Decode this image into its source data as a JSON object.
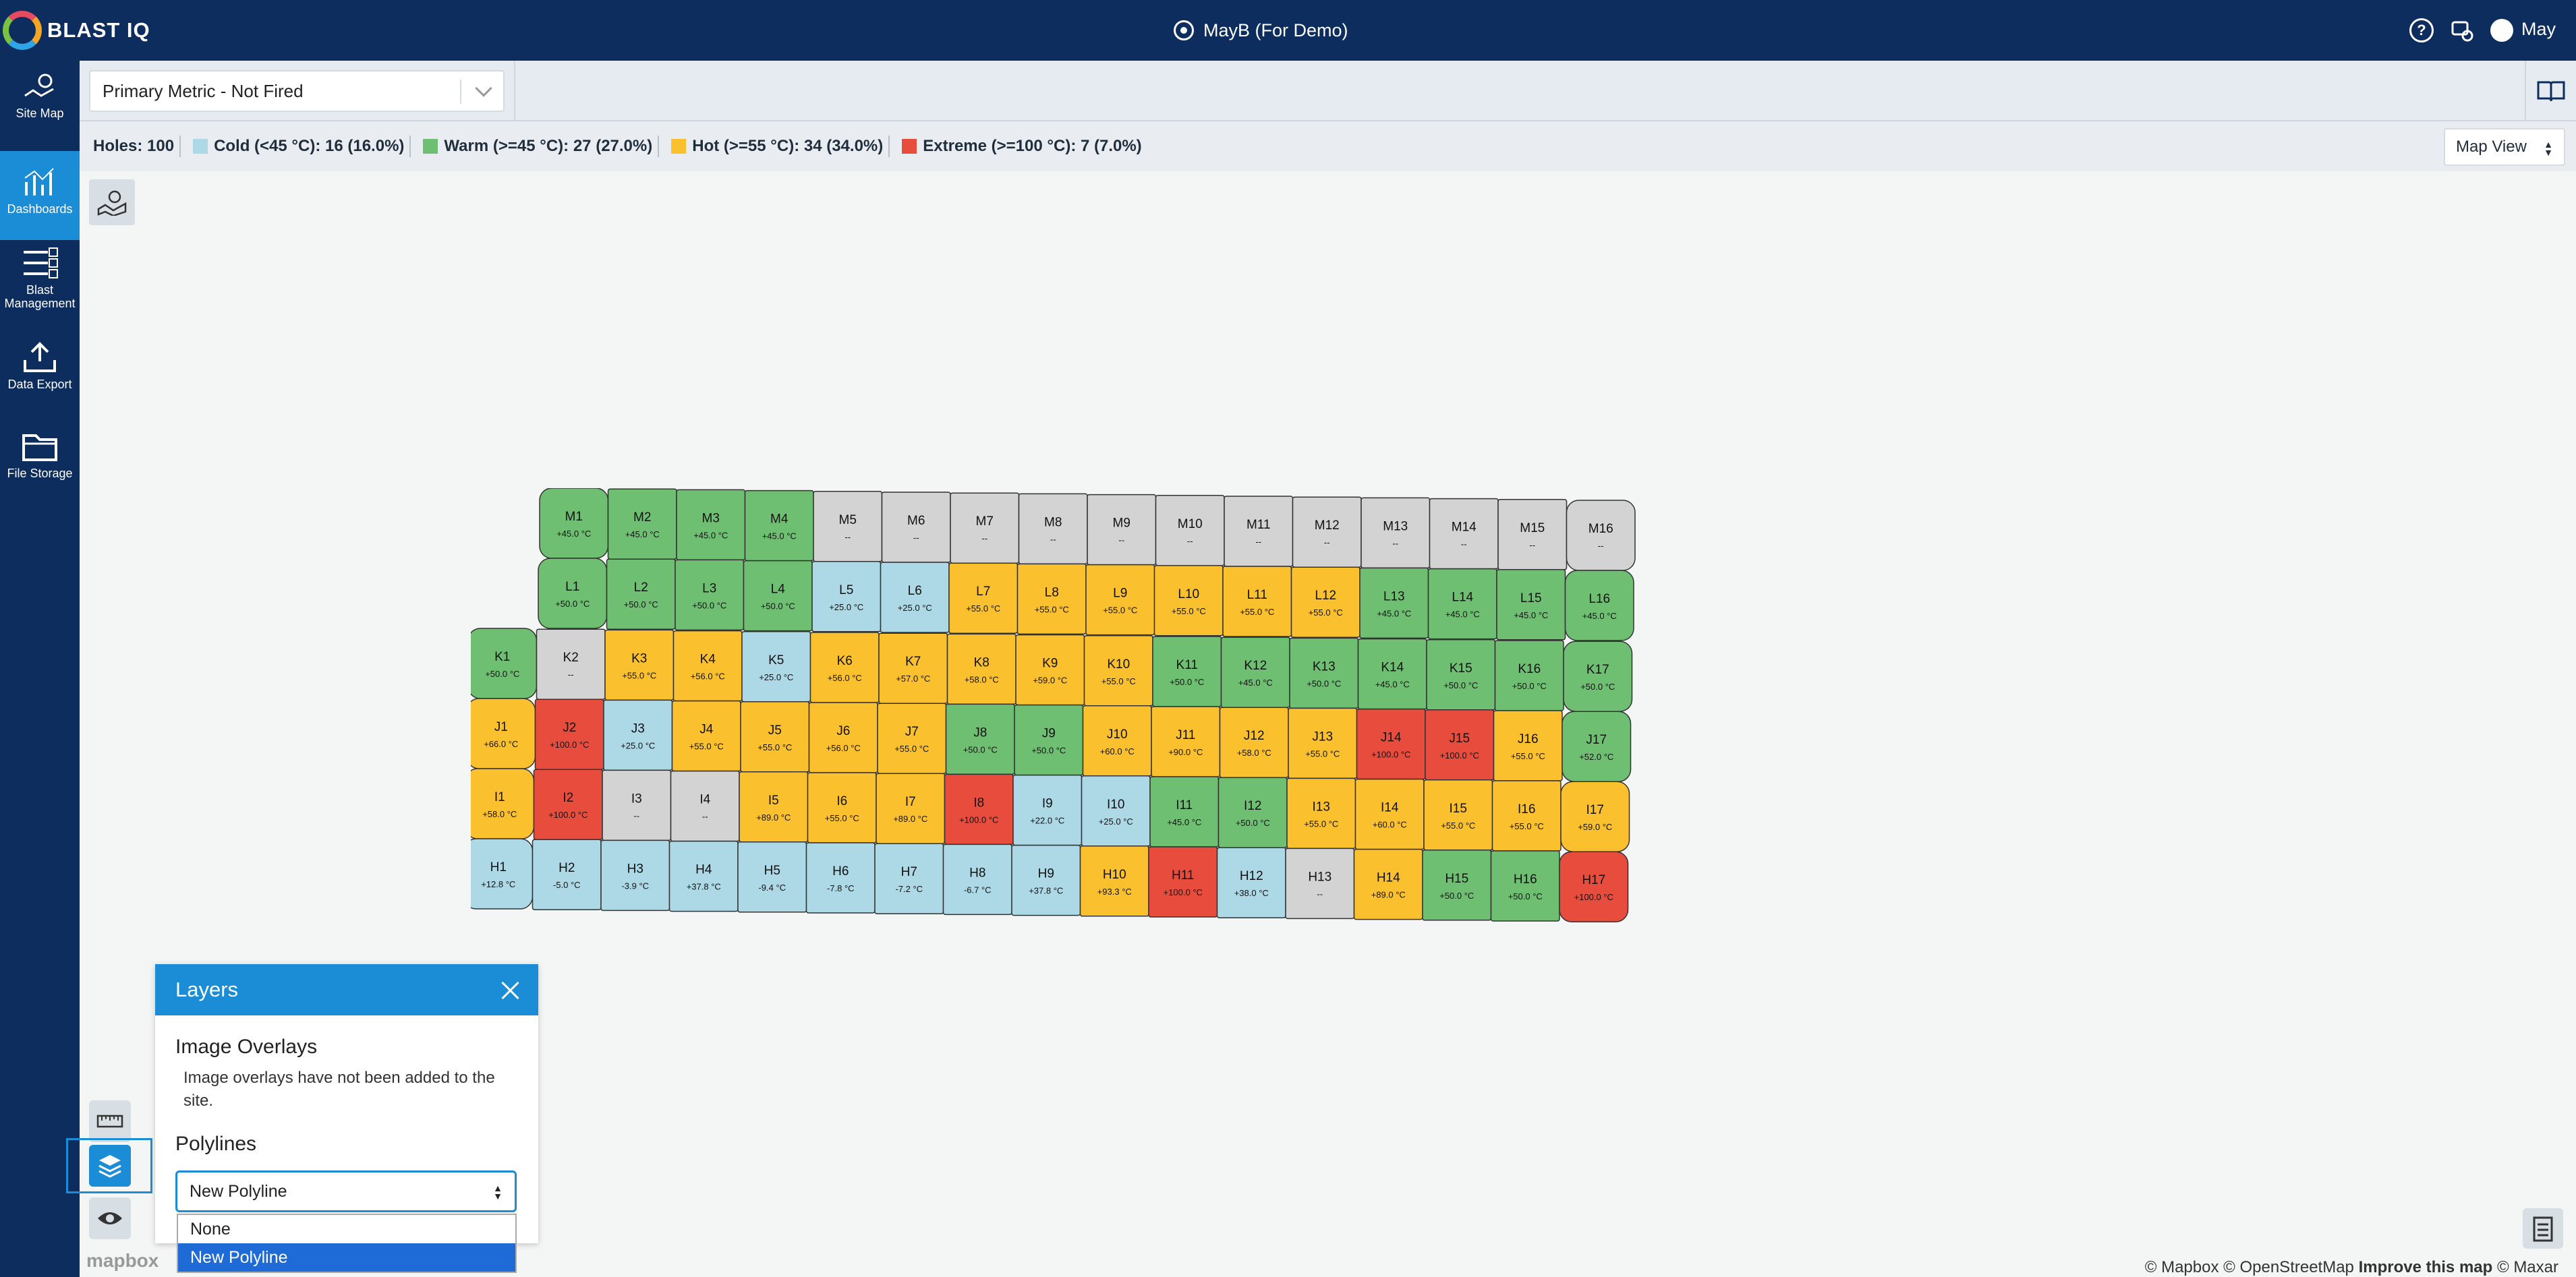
{
  "app": {
    "brand": "BLAST IQ",
    "site_title": "MayB (For Demo)",
    "user": "May"
  },
  "sidebar": {
    "items": [
      {
        "label": "Site Map",
        "icon": "map-icon",
        "active": false
      },
      {
        "label": "Dashboards",
        "icon": "chart-icon",
        "active": true
      },
      {
        "label": "Blast Management",
        "icon": "list-icon",
        "active": false
      },
      {
        "label": "Data Export",
        "icon": "upload-icon",
        "active": false
      },
      {
        "label": "File Storage",
        "icon": "folder-icon",
        "active": false
      }
    ]
  },
  "toolbar": {
    "metric": "Primary Metric - Not Fired"
  },
  "legend": {
    "holes": "Holes: 100",
    "items": [
      {
        "label": "Cold (<45 °C): 16 (16.0%)",
        "color": "#add8e6"
      },
      {
        "label": "Warm (>=45 °C): 27 (27.0%)",
        "color": "#6fbf73"
      },
      {
        "label": "Hot (>=55 °C): 34 (34.0%)",
        "color": "#fbc02d"
      },
      {
        "label": "Extreme (>=100 °C): 7 (7.0%)",
        "color": "#e74c3c"
      }
    ],
    "view": "Map View"
  },
  "colors": {
    "cold": "#add8e6",
    "warm": "#6fbf73",
    "hot": "#fbc02d",
    "extreme": "#e74c3c",
    "none": "#d3d3d3"
  },
  "grid": {
    "rows": [
      {
        "row": "M",
        "cells": [
          [
            "M1",
            "+45.0 °C",
            "warm"
          ],
          [
            "M2",
            "+45.0 °C",
            "warm"
          ],
          [
            "M3",
            "+45.0 °C",
            "warm"
          ],
          [
            "M4",
            "+45.0 °C",
            "warm"
          ],
          [
            "M5",
            "--",
            "none"
          ],
          [
            "M6",
            "--",
            "none"
          ],
          [
            "M7",
            "--",
            "none"
          ],
          [
            "M8",
            "--",
            "none"
          ],
          [
            "M9",
            "--",
            "none"
          ],
          [
            "M10",
            "--",
            "none"
          ],
          [
            "M11",
            "--",
            "none"
          ],
          [
            "M12",
            "--",
            "none"
          ],
          [
            "M13",
            "--",
            "none"
          ],
          [
            "M14",
            "--",
            "none"
          ],
          [
            "M15",
            "--",
            "none"
          ],
          [
            "M16",
            "--",
            "none"
          ]
        ]
      },
      {
        "row": "L",
        "cells": [
          [
            "L1",
            "+50.0 °C",
            "warm"
          ],
          [
            "L2",
            "+50.0 °C",
            "warm"
          ],
          [
            "L3",
            "+50.0 °C",
            "warm"
          ],
          [
            "L4",
            "+50.0 °C",
            "warm"
          ],
          [
            "L5",
            "+25.0 °C",
            "cold"
          ],
          [
            "L6",
            "+25.0 °C",
            "cold"
          ],
          [
            "L7",
            "+55.0 °C",
            "hot"
          ],
          [
            "L8",
            "+55.0 °C",
            "hot"
          ],
          [
            "L9",
            "+55.0 °C",
            "hot"
          ],
          [
            "L10",
            "+55.0 °C",
            "hot"
          ],
          [
            "L11",
            "+55.0 °C",
            "hot"
          ],
          [
            "L12",
            "+55.0 °C",
            "hot"
          ],
          [
            "L13",
            "+45.0 °C",
            "warm"
          ],
          [
            "L14",
            "+45.0 °C",
            "warm"
          ],
          [
            "L15",
            "+45.0 °C",
            "warm"
          ],
          [
            "L16",
            "+45.0 °C",
            "warm"
          ]
        ]
      },
      {
        "row": "K",
        "cells": [
          [
            "K1",
            "+50.0 °C",
            "warm"
          ],
          [
            "K2",
            "--",
            "none"
          ],
          [
            "K3",
            "+55.0 °C",
            "hot"
          ],
          [
            "K4",
            "+56.0 °C",
            "hot"
          ],
          [
            "K5",
            "+25.0 °C",
            "cold"
          ],
          [
            "K6",
            "+56.0 °C",
            "hot"
          ],
          [
            "K7",
            "+57.0 °C",
            "hot"
          ],
          [
            "K8",
            "+58.0 °C",
            "hot"
          ],
          [
            "K9",
            "+59.0 °C",
            "hot"
          ],
          [
            "K10",
            "+55.0 °C",
            "hot"
          ],
          [
            "K11",
            "+50.0 °C",
            "warm"
          ],
          [
            "K12",
            "+45.0 °C",
            "warm"
          ],
          [
            "K13",
            "+50.0 °C",
            "warm"
          ],
          [
            "K14",
            "+45.0 °C",
            "warm"
          ],
          [
            "K15",
            "+50.0 °C",
            "warm"
          ],
          [
            "K16",
            "+50.0 °C",
            "warm"
          ],
          [
            "K17",
            "+50.0 °C",
            "warm"
          ]
        ]
      },
      {
        "row": "J",
        "cells": [
          [
            "J1",
            "+66.0 °C",
            "hot"
          ],
          [
            "J2",
            "+100.0 °C",
            "extreme"
          ],
          [
            "J3",
            "+25.0 °C",
            "cold"
          ],
          [
            "J4",
            "+55.0 °C",
            "hot"
          ],
          [
            "J5",
            "+55.0 °C",
            "hot"
          ],
          [
            "J6",
            "+56.0 °C",
            "hot"
          ],
          [
            "J7",
            "+55.0 °C",
            "hot"
          ],
          [
            "J8",
            "+50.0 °C",
            "warm"
          ],
          [
            "J9",
            "+50.0 °C",
            "warm"
          ],
          [
            "J10",
            "+60.0 °C",
            "hot"
          ],
          [
            "J11",
            "+90.0 °C",
            "hot"
          ],
          [
            "J12",
            "+58.0 °C",
            "hot"
          ],
          [
            "J13",
            "+55.0 °C",
            "hot"
          ],
          [
            "J14",
            "+100.0 °C",
            "extreme"
          ],
          [
            "J15",
            "+100.0 °C",
            "extreme"
          ],
          [
            "J16",
            "+55.0 °C",
            "hot"
          ],
          [
            "J17",
            "+52.0 °C",
            "warm"
          ]
        ]
      },
      {
        "row": "I",
        "cells": [
          [
            "I1",
            "+58.0 °C",
            "hot"
          ],
          [
            "I2",
            "+100.0 °C",
            "extreme"
          ],
          [
            "I3",
            "--",
            "none"
          ],
          [
            "I4",
            "--",
            "none"
          ],
          [
            "I5",
            "+89.0 °C",
            "hot"
          ],
          [
            "I6",
            "+55.0 °C",
            "hot"
          ],
          [
            "I7",
            "+89.0 °C",
            "hot"
          ],
          [
            "I8",
            "+100.0 °C",
            "extreme"
          ],
          [
            "I9",
            "+22.0 °C",
            "cold"
          ],
          [
            "I10",
            "+25.0 °C",
            "cold"
          ],
          [
            "I11",
            "+45.0 °C",
            "warm"
          ],
          [
            "I12",
            "+50.0 °C",
            "warm"
          ],
          [
            "I13",
            "+55.0 °C",
            "hot"
          ],
          [
            "I14",
            "+60.0 °C",
            "hot"
          ],
          [
            "I15",
            "+55.0 °C",
            "hot"
          ],
          [
            "I16",
            "+55.0 °C",
            "hot"
          ],
          [
            "I17",
            "+59.0 °C",
            "hot"
          ]
        ]
      },
      {
        "row": "H",
        "cells": [
          [
            "H1",
            "+12.8 °C",
            "cold"
          ],
          [
            "H2",
            "-5.0 °C",
            "cold"
          ],
          [
            "H3",
            "-3.9 °C",
            "cold"
          ],
          [
            "H4",
            "+37.8 °C",
            "cold"
          ],
          [
            "H5",
            "-9.4 °C",
            "cold"
          ],
          [
            "H6",
            "-7.8 °C",
            "cold"
          ],
          [
            "H7",
            "-7.2 °C",
            "cold"
          ],
          [
            "H8",
            "-6.7 °C",
            "cold"
          ],
          [
            "H9",
            "+37.8 °C",
            "cold"
          ],
          [
            "H10",
            "+93.3 °C",
            "hot"
          ],
          [
            "H11",
            "+100.0 °C",
            "extreme"
          ],
          [
            "H12",
            "+38.0 °C",
            "cold"
          ],
          [
            "H13",
            "--",
            "none"
          ],
          [
            "H14",
            "+89.0 °C",
            "hot"
          ],
          [
            "H15",
            "+50.0 °C",
            "warm"
          ],
          [
            "H16",
            "+50.0 °C",
            "warm"
          ],
          [
            "H17",
            "+100.0 °C",
            "extreme"
          ]
        ]
      }
    ]
  },
  "layers": {
    "title": "Layers",
    "overlays_heading": "Image Overlays",
    "overlays_text": "Image overlays have not been added to the site.",
    "polylines_heading": "Polylines",
    "polyline_value": "New Polyline",
    "polyline_options": [
      "None",
      "New Polyline"
    ]
  },
  "map": {
    "mapbox": "mapbox",
    "attribution": {
      "text": "© Mapbox © OpenStreetMap ",
      "improve": "Improve this map",
      "suffix": " © Maxar"
    }
  }
}
